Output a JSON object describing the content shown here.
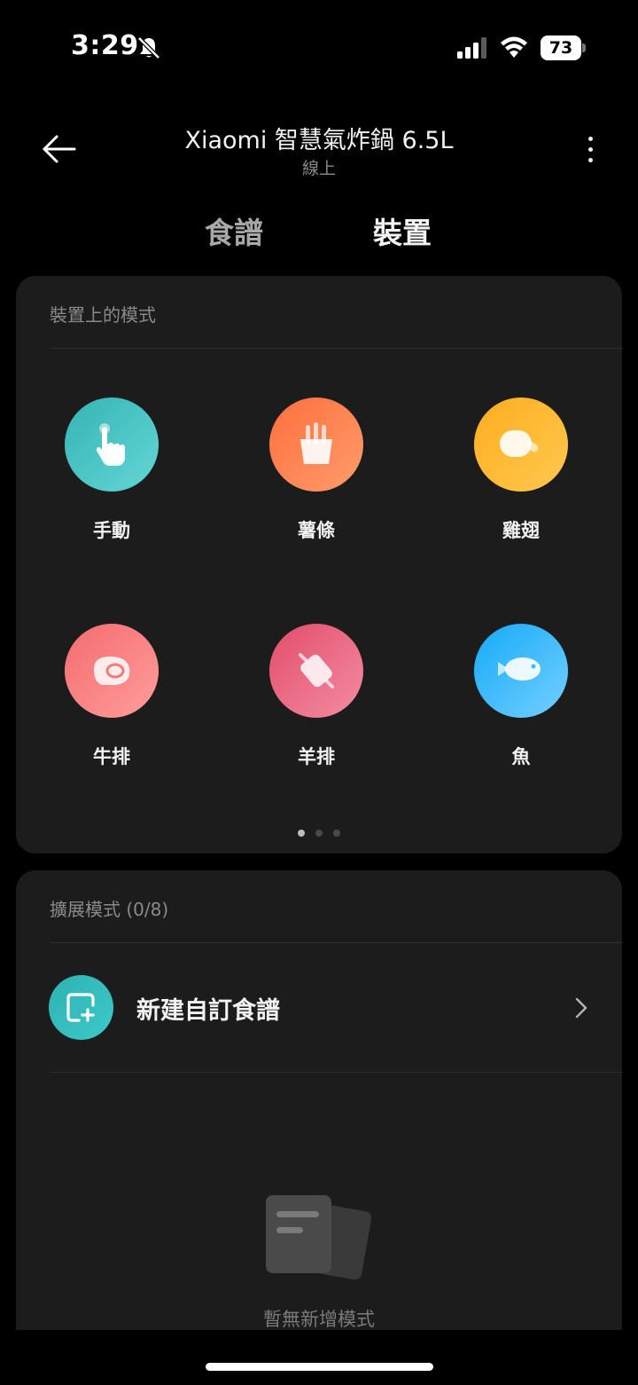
{
  "status_bar": {
    "time": "3:29",
    "battery": "73",
    "icons": [
      "bell-slash-icon",
      "signal-icon",
      "wifi-icon",
      "battery-icon"
    ]
  },
  "header": {
    "title": "Xiaomi 智慧氣炸鍋 6.5L",
    "subtitle": "線上",
    "back_icon": "arrow-left-icon",
    "more_icon": "more-vertical-icon"
  },
  "tabs": [
    {
      "label": "食譜",
      "active": false
    },
    {
      "label": "裝置",
      "active": true
    }
  ],
  "device_modes": {
    "title": "裝置上的模式",
    "items": [
      {
        "label": "手動",
        "icon": "hand-pointer-icon",
        "color": "#4ac6c6"
      },
      {
        "label": "薯條",
        "icon": "fries-icon",
        "color": "#ff8550"
      },
      {
        "label": "雞翅",
        "icon": "chicken-wing-icon",
        "color": "#ffbb36"
      },
      {
        "label": "牛排",
        "icon": "steak-icon",
        "color": "#f9847f"
      },
      {
        "label": "羊排",
        "icon": "lamb-chop-icon",
        "color": "#ea6c87"
      },
      {
        "label": "魚",
        "icon": "fish-icon",
        "color": "#3dbdfb"
      }
    ],
    "pager": {
      "pages": 3,
      "current": 1
    }
  },
  "extended_modes": {
    "title": "擴展模式 (0/8)",
    "new_recipe_label": "新建自訂食譜",
    "new_recipe_icon": "add-square-icon",
    "empty_text": "暫無新增模式",
    "empty_icon": "empty-documents-icon"
  },
  "colors": {
    "background": "#000000",
    "card": "#1c1c1c",
    "accent_teal": "#2eb2b3"
  }
}
